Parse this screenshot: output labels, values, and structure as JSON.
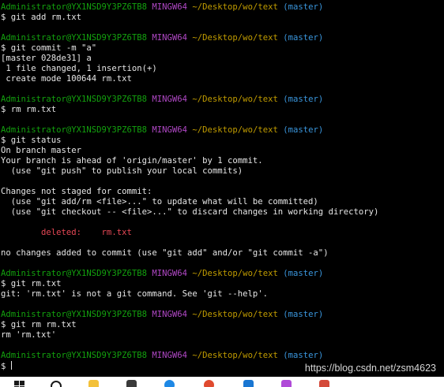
{
  "terminal": {
    "prompt_user": "Administrator@YX1NSD9Y3PZ6TB8",
    "prompt_host": "MINGW64",
    "prompt_path": "~/Desktop/wo/text",
    "prompt_branch": "(master)",
    "commands": {
      "c1": "$ git add rm.txt",
      "c2": "$ git commit -m \"a\"",
      "c3": "$ rm rm.txt",
      "c4": "$ git status",
      "c5": "$ git rm.txt",
      "c6": "$ git rm rm.txt",
      "c7": "$ "
    },
    "output": {
      "commit_1": "[master 028de31] a",
      "commit_2": " 1 file changed, 1 insertion(+)",
      "commit_3": " create mode 100644 rm.txt",
      "status_1": "On branch master",
      "status_2": "Your branch is ahead of 'origin/master' by 1 commit.",
      "status_3": "  (use \"git push\" to publish your local commits)",
      "status_4": "Changes not staged for commit:",
      "status_5": "  (use \"git add/rm <file>...\" to update what will be committed)",
      "status_6": "  (use \"git checkout -- <file>...\" to discard changes in working directory)",
      "status_deleted_label": "        deleted:    rm.txt",
      "status_7": "no changes added to commit (use \"git add\" and/or \"git commit -a\")",
      "error_1": "git: 'rm.txt' is not a git command. See 'git --help'.",
      "rm_result": "rm 'rm.txt'"
    }
  },
  "watermark": "https://blog.csdn.net/zsm4623",
  "colors": {
    "background": "#000000",
    "user": "#13a10e",
    "host": "#b148c6",
    "path": "#c19c00",
    "branch": "#3a96dd",
    "text": "#e6e6e6",
    "deleted": "#e74856"
  },
  "taskbar_icons": [
    "windows-start-icon",
    "search-icon",
    "file-explorer-icon",
    "app-icon",
    "browser-icon",
    "chrome-icon",
    "vscode-icon",
    "photoshop-icon",
    "app-icon-2"
  ]
}
